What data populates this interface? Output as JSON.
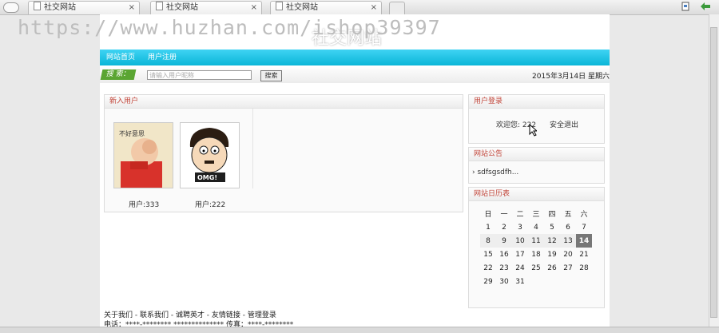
{
  "browser": {
    "tabs": [
      {
        "label": "社交网站"
      },
      {
        "label": "社交网站"
      },
      {
        "label": "社交网站"
      }
    ],
    "close_glyph": "×"
  },
  "watermark": "https://www.huzhan.com/ishop39397",
  "site": {
    "title": "社交网站",
    "nav": [
      "网站首页",
      "用户注册"
    ],
    "search": {
      "label": "搜 索：",
      "placeholder": "请输入用户昵称",
      "button": "搜索"
    },
    "date": "2015年3月14日 星期六"
  },
  "new_users": {
    "title": "新入用户",
    "users": [
      {
        "caption": "用户:333",
        "image_text": "不好意思"
      },
      {
        "caption": "用户:222",
        "image_text": "OMG!"
      }
    ]
  },
  "user_login": {
    "title": "用户登录",
    "welcome": "欢迎您:",
    "username": "222",
    "logout": "安全退出"
  },
  "announcement": {
    "title": "网站公告",
    "items": [
      "sdfsgsdfh..."
    ]
  },
  "calendar": {
    "title": "网站日历表",
    "weekdays": [
      "日",
      "一",
      "二",
      "三",
      "四",
      "五",
      "六"
    ],
    "weeks": [
      [
        "1",
        "2",
        "3",
        "4",
        "5",
        "6",
        "7"
      ],
      [
        "8",
        "9",
        "10",
        "11",
        "12",
        "13",
        "14"
      ],
      [
        "15",
        "16",
        "17",
        "18",
        "19",
        "20",
        "21"
      ],
      [
        "22",
        "23",
        "24",
        "25",
        "26",
        "27",
        "28"
      ],
      [
        "29",
        "30",
        "31",
        "",
        "",
        "",
        ""
      ]
    ],
    "today": "14"
  },
  "footer": {
    "links": "关于我们 - 联系我们 - 诚聘英才 - 友情链接 - 管理登录",
    "contact": "电话：****-******** **************  传真：****-********"
  }
}
